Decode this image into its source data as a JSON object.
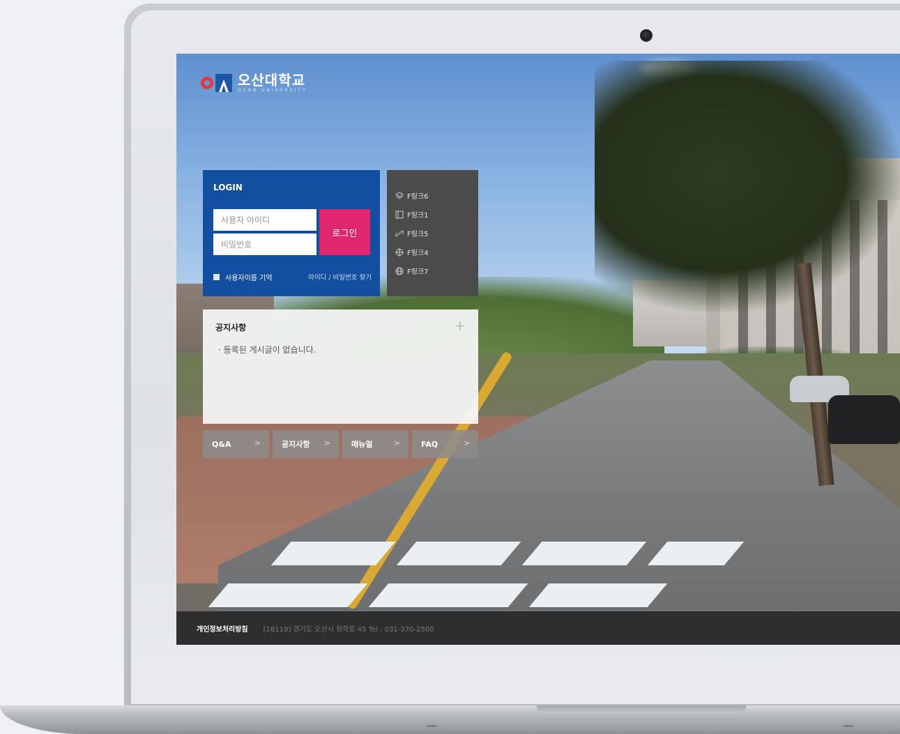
{
  "logo": {
    "name_ko": "오산대학교",
    "name_en": "OSAN UNIVERSITY"
  },
  "login": {
    "title": "LOGIN",
    "username_placeholder": "사용자 아이디",
    "password_placeholder": "비밀번호",
    "submit_label": "로그인",
    "remember_label": "사용자이름 기억",
    "find_link": "아이디 / 비밀번호 찾기"
  },
  "quick_links": [
    {
      "label": "F링크6",
      "icon": "layers-icon"
    },
    {
      "label": "F링크1",
      "icon": "book-icon"
    },
    {
      "label": "F링크5",
      "icon": "link-icon"
    },
    {
      "label": "F링크4",
      "icon": "crosshair-icon"
    },
    {
      "label": "F링크7",
      "icon": "globe-icon"
    }
  ],
  "notice": {
    "title": "공지사항",
    "more": "+",
    "empty_message": "· 등록된 게시글이 없습니다."
  },
  "bottom_buttons": [
    {
      "label": "Q&A"
    },
    {
      "label": "공지사항"
    },
    {
      "label": "매뉴얼"
    },
    {
      "label": "FAQ"
    }
  ],
  "chevron": ">",
  "footer": {
    "policy": "개인정보처리방침",
    "address": "[18119] 경기도 오산시 청학로 45   Tel : 031-370-2500"
  },
  "colors": {
    "login_bg": "#124fa0",
    "login_button": "#e0266e",
    "quick_bg": "#4b4b4b",
    "footer_bg": "#2e2e2e"
  }
}
